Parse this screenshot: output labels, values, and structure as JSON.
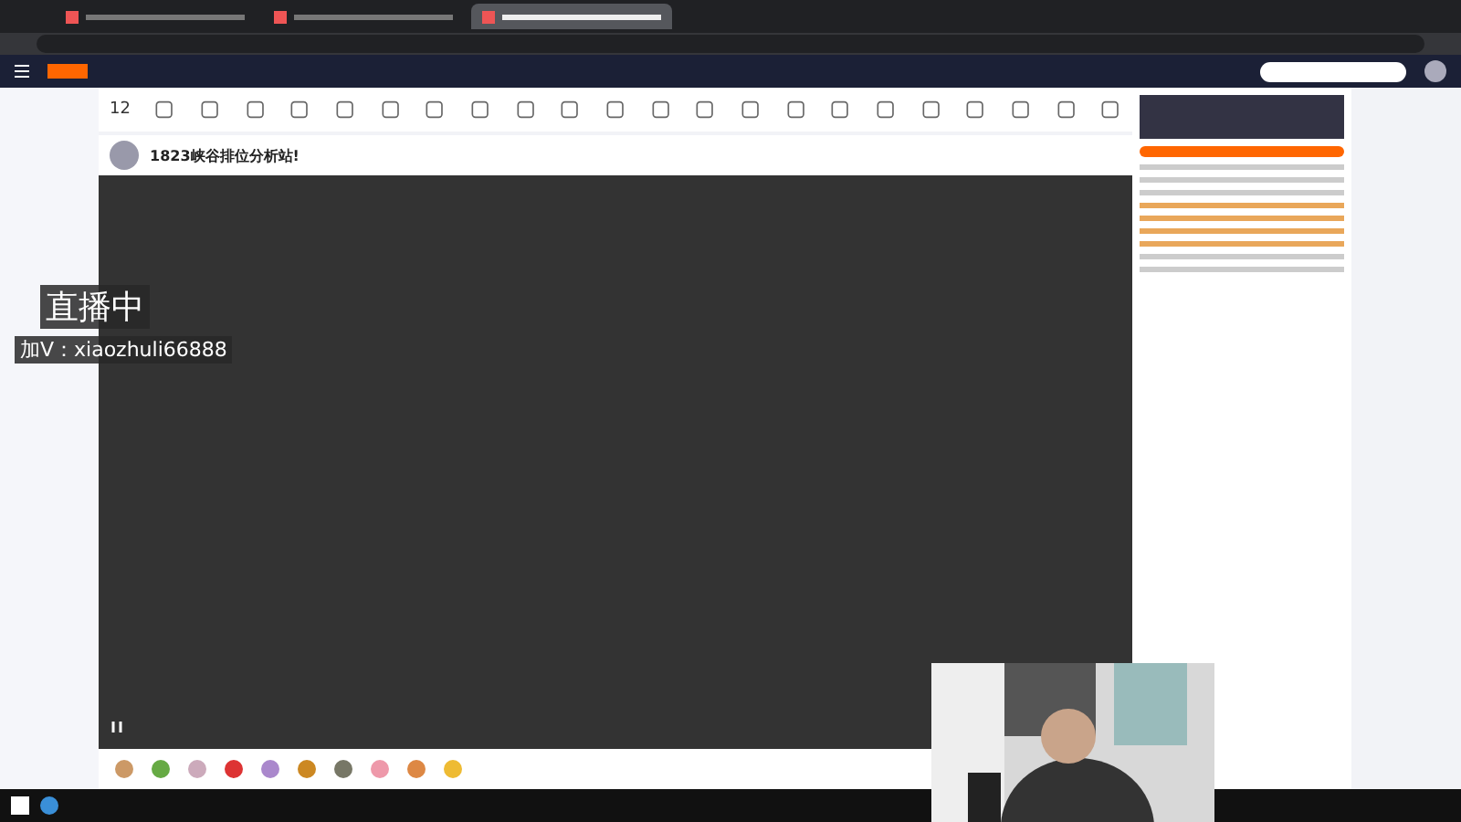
{
  "browser": {
    "tabs": [
      {
        "selected": false
      },
      {
        "selected": false
      },
      {
        "selected": true
      }
    ]
  },
  "toolbar": {
    "count": "12"
  },
  "room": {
    "title": "1823峡谷排位分析站!"
  },
  "player": {
    "overlay_title": "直播中",
    "overlay_contact": "加V：xiaozhuli66888"
  }
}
